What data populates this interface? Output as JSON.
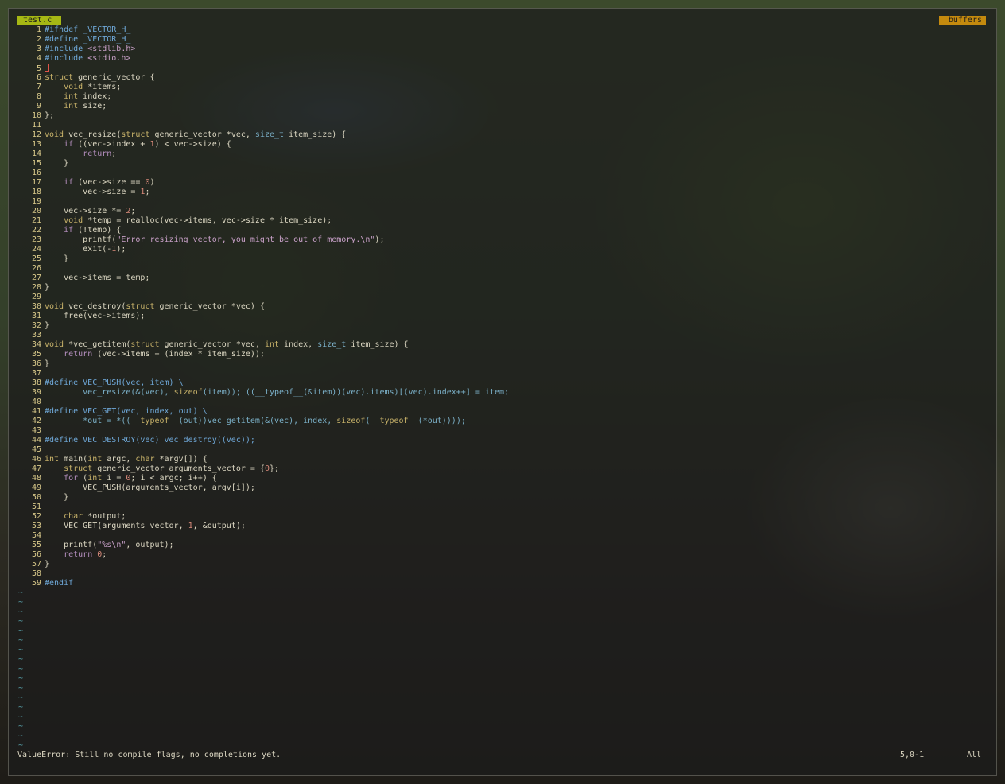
{
  "tabline": {
    "active_tab": "test.c",
    "buffers_label": "buffers"
  },
  "editor": {
    "lines": [
      {
        "n": "1",
        "segs": [
          [
            "pre",
            "#ifndef _VECTOR_H_"
          ]
        ]
      },
      {
        "n": "2",
        "segs": [
          [
            "pre",
            "#define _VECTOR_H_"
          ]
        ]
      },
      {
        "n": "3",
        "segs": [
          [
            "pre",
            "#include "
          ],
          [
            "str",
            "<stdlib.h>"
          ]
        ]
      },
      {
        "n": "4",
        "segs": [
          [
            "pre",
            "#include "
          ],
          [
            "str",
            "<stdio.h>"
          ]
        ]
      },
      {
        "n": "5",
        "segs": [],
        "cursor": true
      },
      {
        "n": "6",
        "segs": [
          [
            "type",
            "struct"
          ],
          [
            "",
            " generic_vector {"
          ]
        ]
      },
      {
        "n": "7",
        "segs": [
          [
            "",
            "    "
          ],
          [
            "type",
            "void"
          ],
          [
            "",
            " *items;"
          ]
        ]
      },
      {
        "n": "8",
        "segs": [
          [
            "",
            "    "
          ],
          [
            "type",
            "int"
          ],
          [
            "",
            " index;"
          ]
        ]
      },
      {
        "n": "9",
        "segs": [
          [
            "",
            "    "
          ],
          [
            "type",
            "int"
          ],
          [
            "",
            " size;"
          ]
        ]
      },
      {
        "n": "10",
        "segs": [
          [
            "",
            "};"
          ]
        ]
      },
      {
        "n": "11",
        "segs": []
      },
      {
        "n": "12",
        "segs": [
          [
            "type",
            "void"
          ],
          [
            "",
            " vec_resize("
          ],
          [
            "type",
            "struct"
          ],
          [
            "",
            " generic_vector *vec, "
          ],
          [
            "macro",
            "size_t"
          ],
          [
            "",
            " item_size) {"
          ]
        ]
      },
      {
        "n": "13",
        "segs": [
          [
            "",
            "    "
          ],
          [
            "key",
            "if"
          ],
          [
            "",
            " ((vec->index + "
          ],
          [
            "num",
            "1"
          ],
          [
            "",
            ") < vec->size) {"
          ]
        ]
      },
      {
        "n": "14",
        "segs": [
          [
            "",
            "        "
          ],
          [
            "key",
            "return"
          ],
          [
            "",
            ";"
          ]
        ]
      },
      {
        "n": "15",
        "segs": [
          [
            "",
            "    }"
          ]
        ]
      },
      {
        "n": "16",
        "segs": []
      },
      {
        "n": "17",
        "segs": [
          [
            "",
            "    "
          ],
          [
            "key",
            "if"
          ],
          [
            "",
            " (vec->size == "
          ],
          [
            "num",
            "0"
          ],
          [
            "",
            ")"
          ]
        ]
      },
      {
        "n": "18",
        "segs": [
          [
            "",
            "        vec->size = "
          ],
          [
            "num",
            "1"
          ],
          [
            "",
            ";"
          ]
        ]
      },
      {
        "n": "19",
        "segs": []
      },
      {
        "n": "20",
        "segs": [
          [
            "",
            "    vec->size *= "
          ],
          [
            "num",
            "2"
          ],
          [
            "",
            ";"
          ]
        ]
      },
      {
        "n": "21",
        "segs": [
          [
            "",
            "    "
          ],
          [
            "type",
            "void"
          ],
          [
            "",
            " *temp = realloc(vec->items, vec->size * item_size);"
          ]
        ]
      },
      {
        "n": "22",
        "segs": [
          [
            "",
            "    "
          ],
          [
            "key",
            "if"
          ],
          [
            "",
            " (!temp) {"
          ]
        ]
      },
      {
        "n": "23",
        "segs": [
          [
            "",
            "        printf("
          ],
          [
            "str",
            "\"Error resizing vector, you might be out of memory.\\n\""
          ],
          [
            "",
            ");"
          ]
        ]
      },
      {
        "n": "24",
        "segs": [
          [
            "",
            "        exit(-"
          ],
          [
            "num",
            "1"
          ],
          [
            "",
            ");"
          ]
        ]
      },
      {
        "n": "25",
        "segs": [
          [
            "",
            "    }"
          ]
        ]
      },
      {
        "n": "26",
        "segs": []
      },
      {
        "n": "27",
        "segs": [
          [
            "",
            "    vec->items = temp;"
          ]
        ]
      },
      {
        "n": "28",
        "segs": [
          [
            "",
            "}"
          ]
        ]
      },
      {
        "n": "29",
        "segs": []
      },
      {
        "n": "30",
        "segs": [
          [
            "type",
            "void"
          ],
          [
            "",
            " vec_destroy("
          ],
          [
            "type",
            "struct"
          ],
          [
            "",
            " generic_vector *vec) {"
          ]
        ]
      },
      {
        "n": "31",
        "segs": [
          [
            "",
            "    free(vec->items);"
          ]
        ]
      },
      {
        "n": "32",
        "segs": [
          [
            "",
            "}"
          ]
        ]
      },
      {
        "n": "33",
        "segs": []
      },
      {
        "n": "34",
        "segs": [
          [
            "type",
            "void"
          ],
          [
            "",
            " *vec_getitem("
          ],
          [
            "type",
            "struct"
          ],
          [
            "",
            " generic_vector *vec, "
          ],
          [
            "type",
            "int"
          ],
          [
            "",
            " index, "
          ],
          [
            "macro",
            "size_t"
          ],
          [
            "",
            " item_size) {"
          ]
        ]
      },
      {
        "n": "35",
        "segs": [
          [
            "",
            "    "
          ],
          [
            "key",
            "return"
          ],
          [
            "",
            " (vec->items + (index * item_size));"
          ]
        ]
      },
      {
        "n": "36",
        "segs": [
          [
            "",
            "}"
          ]
        ]
      },
      {
        "n": "37",
        "segs": []
      },
      {
        "n": "38",
        "segs": [
          [
            "pre",
            "#define VEC_PUSH(vec, item) \\"
          ]
        ]
      },
      {
        "n": "39",
        "segs": [
          [
            "macro",
            "        vec_resize(&(vec), "
          ],
          [
            "type",
            "sizeof"
          ],
          [
            "macro",
            "(item)); ((__typeof__(&item))(vec).items)[(vec).index++] = item;"
          ]
        ]
      },
      {
        "n": "40",
        "segs": []
      },
      {
        "n": "41",
        "segs": [
          [
            "pre",
            "#define VEC_GET(vec, index, out) \\"
          ]
        ]
      },
      {
        "n": "42",
        "segs": [
          [
            "macro",
            "        *out = *(("
          ],
          [
            "type",
            "__typeof__"
          ],
          [
            "macro",
            "(out))vec_getitem(&(vec), index, "
          ],
          [
            "type",
            "sizeof"
          ],
          [
            "macro",
            "("
          ],
          [
            "type",
            "__typeof__"
          ],
          [
            "macro",
            "(*out))));"
          ]
        ]
      },
      {
        "n": "43",
        "segs": []
      },
      {
        "n": "44",
        "segs": [
          [
            "pre",
            "#define VEC_DESTROY(vec) vec_destroy((vec));"
          ]
        ]
      },
      {
        "n": "45",
        "segs": []
      },
      {
        "n": "46",
        "segs": [
          [
            "type",
            "int"
          ],
          [
            "",
            " main("
          ],
          [
            "type",
            "int"
          ],
          [
            "",
            " argc, "
          ],
          [
            "type",
            "char"
          ],
          [
            "",
            " *argv[]) {"
          ]
        ]
      },
      {
        "n": "47",
        "segs": [
          [
            "",
            "    "
          ],
          [
            "type",
            "struct"
          ],
          [
            "",
            " generic_vector arguments_vector = {"
          ],
          [
            "num",
            "0"
          ],
          [
            "",
            "};"
          ]
        ]
      },
      {
        "n": "48",
        "segs": [
          [
            "",
            "    "
          ],
          [
            "key",
            "for"
          ],
          [
            "",
            " ("
          ],
          [
            "type",
            "int"
          ],
          [
            "",
            " i = "
          ],
          [
            "num",
            "0"
          ],
          [
            "",
            "; i < argc; i++) {"
          ]
        ]
      },
      {
        "n": "49",
        "segs": [
          [
            "",
            "        VEC_PUSH(arguments_vector, argv[i]);"
          ]
        ]
      },
      {
        "n": "50",
        "segs": [
          [
            "",
            "    }"
          ]
        ]
      },
      {
        "n": "51",
        "segs": []
      },
      {
        "n": "52",
        "segs": [
          [
            "",
            "    "
          ],
          [
            "type",
            "char"
          ],
          [
            "",
            " *output;"
          ]
        ]
      },
      {
        "n": "53",
        "segs": [
          [
            "",
            "    VEC_GET(arguments_vector, "
          ],
          [
            "num",
            "1"
          ],
          [
            "",
            ", &output);"
          ]
        ]
      },
      {
        "n": "54",
        "segs": []
      },
      {
        "n": "55",
        "segs": [
          [
            "",
            "    printf("
          ],
          [
            "str",
            "\"%s\\n\""
          ],
          [
            "",
            ", output);"
          ]
        ]
      },
      {
        "n": "56",
        "segs": [
          [
            "",
            "    "
          ],
          [
            "key",
            "return"
          ],
          [
            "",
            " "
          ],
          [
            "num",
            "0"
          ],
          [
            "",
            ";"
          ]
        ]
      },
      {
        "n": "57",
        "segs": [
          [
            "",
            "}"
          ]
        ]
      },
      {
        "n": "58",
        "segs": []
      },
      {
        "n": "59",
        "segs": [
          [
            "pre",
            "#endif"
          ]
        ]
      }
    ],
    "tilde_char": "~",
    "tilde_count": 17
  },
  "statusline": {
    "message": "ValueError: Still no compile flags, no completions yet.",
    "position": "5,0-1",
    "percent": "All"
  },
  "colors": {
    "tab_active_bg": "#a6b814",
    "tab_buffers_bg": "#c48a0e",
    "line_number": "#d9c98a",
    "tilde": "#5aa6b0"
  }
}
